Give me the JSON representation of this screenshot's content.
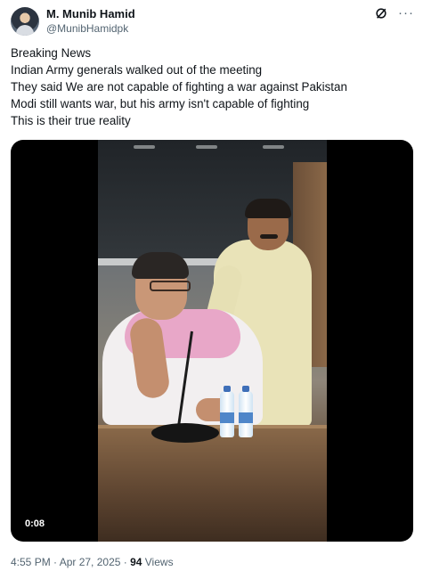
{
  "author": {
    "name": "M. Munib Hamid",
    "handle": "@MunibHamidpk"
  },
  "header_icons": {
    "grok": "grok-icon",
    "more": "more-icon",
    "more_glyph": "···"
  },
  "tweet": {
    "lines": [
      "Breaking News",
      "Indian Army generals walked out of the meeting",
      "They said We are not capable of fighting a war against Pakistan",
      "Modi still wants war, but his army isn't capable of fighting",
      "This is their true reality"
    ]
  },
  "video": {
    "duration": "0:08"
  },
  "meta": {
    "timestamp": "4:55 PM · Apr 27, 2025 · ",
    "views_count": "94",
    "views_label": " Views"
  },
  "colors": {
    "text": "#0f1419",
    "secondary": "#536471",
    "background": "#ffffff"
  }
}
